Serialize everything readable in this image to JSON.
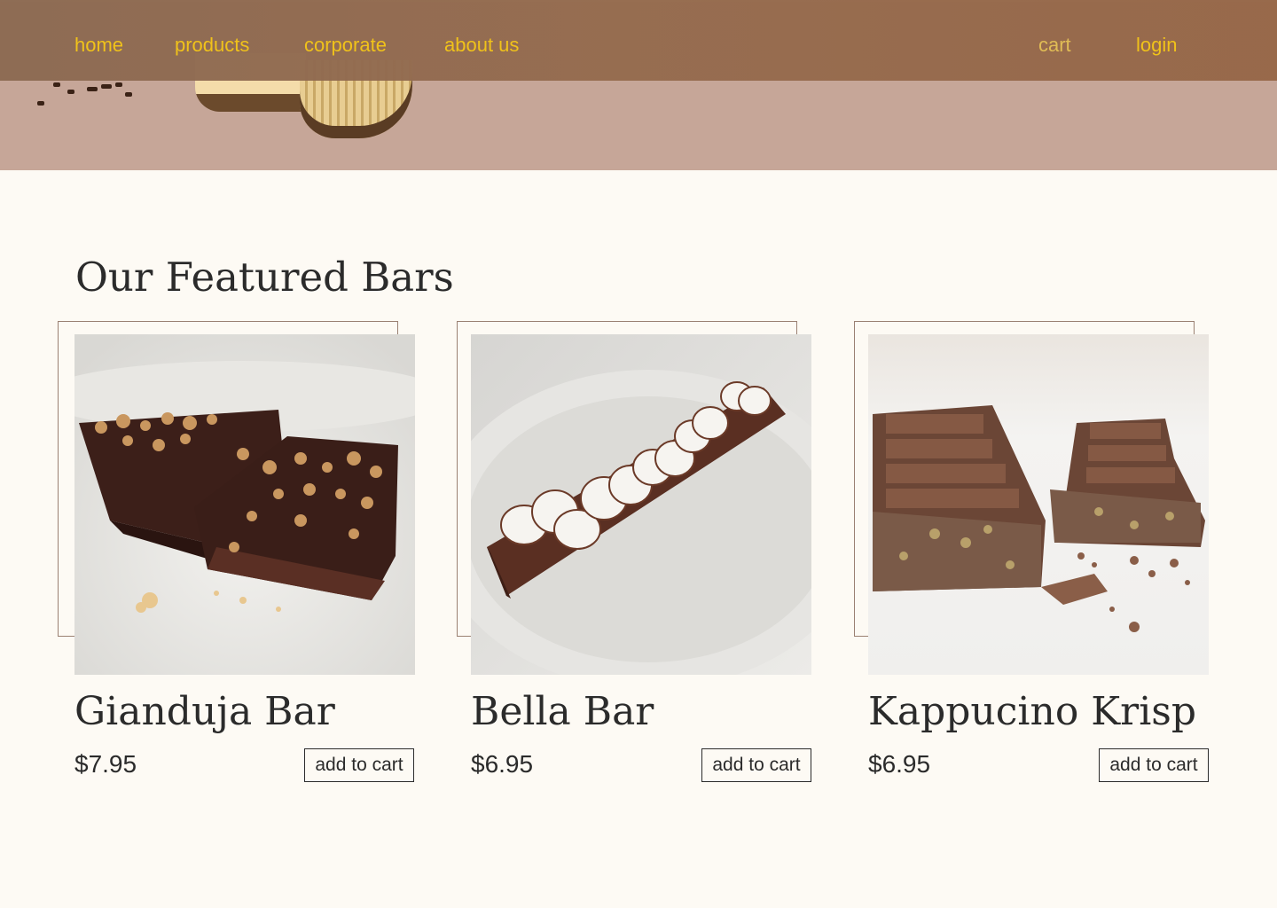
{
  "nav": {
    "left_links": [
      "home",
      "products",
      "corporate",
      "about us"
    ],
    "cart_label": "cart",
    "login_label": "login"
  },
  "featured": {
    "title": "Our Featured Bars",
    "products": [
      {
        "name": "Gianduja Bar",
        "price": "$7.95",
        "button": "add to cart"
      },
      {
        "name": "Bella Bar",
        "price": "$6.95",
        "button": "add to cart"
      },
      {
        "name": "Kappucino Krisp",
        "price": "$6.95",
        "button": "add to cart"
      }
    ]
  },
  "colors": {
    "nav_background": "#8f6a52",
    "nav_link": "#f0c21a",
    "hero_background": "#c6a698",
    "page_background": "#fdfaf4",
    "text": "#2b2b2b"
  }
}
